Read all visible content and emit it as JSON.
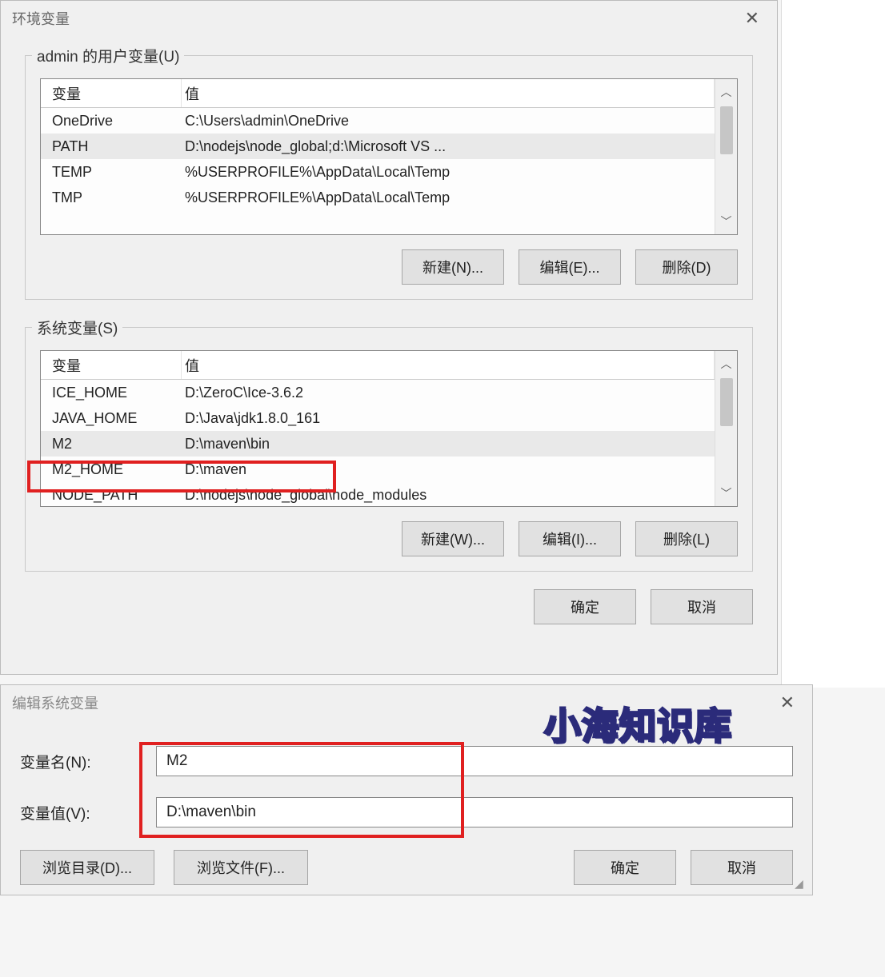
{
  "env_dialog": {
    "title": "环境变量",
    "user_section": {
      "label": "admin 的用户变量(U)",
      "columns": {
        "var": "变量",
        "val": "值"
      },
      "rows": [
        {
          "var": "OneDrive",
          "val": "C:\\Users\\admin\\OneDrive",
          "selected": false
        },
        {
          "var": "PATH",
          "val": "D:\\nodejs\\node_global;d:\\Microsoft VS ...",
          "selected": true
        },
        {
          "var": "TEMP",
          "val": "%USERPROFILE%\\AppData\\Local\\Temp",
          "selected": false
        },
        {
          "var": "TMP",
          "val": "%USERPROFILE%\\AppData\\Local\\Temp",
          "selected": false
        }
      ],
      "buttons": {
        "new": "新建(N)...",
        "edit": "编辑(E)...",
        "delete": "删除(D)"
      }
    },
    "system_section": {
      "label": "系统变量(S)",
      "columns": {
        "var": "变量",
        "val": "值"
      },
      "rows": [
        {
          "var": "ICE_HOME",
          "val": "D:\\ZeroC\\Ice-3.6.2",
          "selected": false
        },
        {
          "var": "JAVA_HOME",
          "val": "D:\\Java\\jdk1.8.0_161",
          "selected": false
        },
        {
          "var": "M2",
          "val": "D:\\maven\\bin",
          "selected": true
        },
        {
          "var": "M2_HOME",
          "val": "D:\\maven",
          "selected": false
        },
        {
          "var": "NODE_PATH",
          "val": "D:\\nodejs\\node_global\\node_modules",
          "selected": false
        }
      ],
      "buttons": {
        "new": "新建(W)...",
        "edit": "编辑(I)...",
        "delete": "删除(L)"
      }
    },
    "footer": {
      "ok": "确定",
      "cancel": "取消"
    }
  },
  "edit_dialog": {
    "title": "编辑系统变量",
    "name_label": "变量名(N):",
    "name_value": "M2",
    "value_label": "变量值(V):",
    "value_value": "D:\\maven\\bin",
    "buttons": {
      "browse_dir": "浏览目录(D)...",
      "browse_file": "浏览文件(F)...",
      "ok": "确定",
      "cancel": "取消"
    }
  },
  "watermark": "小海知识库"
}
